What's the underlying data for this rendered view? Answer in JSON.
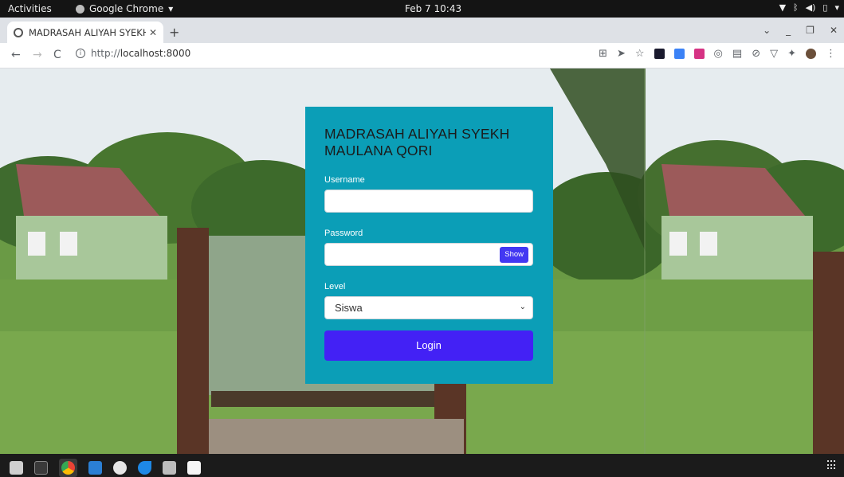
{
  "system": {
    "activities": "Activities",
    "app_menu": "Google Chrome",
    "clock": "Feb 7  10:43"
  },
  "browser": {
    "tab_title": "MADRASAH ALIYAH SYEKH",
    "url_scheme": "http://",
    "url_host": "localhost:8000"
  },
  "login": {
    "title": "MADRASAH ALIYAH SYEKH MAULANA QORI",
    "username_label": "Username",
    "username_value": "",
    "password_label": "Password",
    "password_value": "",
    "show_label": "Show",
    "level_label": "Level",
    "level_selected": "Siswa",
    "login_label": "Login"
  },
  "colors": {
    "card_bg": "#0b9eb7",
    "button_bg": "#4321f5",
    "show_bg": "#4338f2"
  },
  "icons": {
    "taskbar": [
      "files-icon",
      "terminal-icon",
      "chrome-icon",
      "vscode-icon",
      "emoji-icon",
      "mysql-workbench-icon",
      "virtualbox-icon",
      "text-editor-icon"
    ]
  }
}
